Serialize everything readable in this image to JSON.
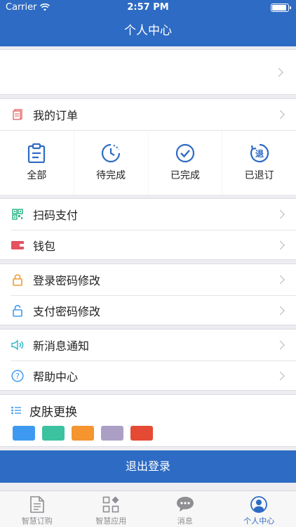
{
  "status_bar": {
    "carrier": "Carrier",
    "time": "2:57 PM"
  },
  "header": {
    "title": "个人中心"
  },
  "orders": {
    "title": "我的订单",
    "items": [
      {
        "label": "全部",
        "icon": "clipboard-icon"
      },
      {
        "label": "待完成",
        "icon": "clock-icon"
      },
      {
        "label": "已完成",
        "icon": "check-circle-icon"
      },
      {
        "label": "已退订",
        "icon": "refund-icon"
      }
    ]
  },
  "payment": {
    "scan_pay": "扫码支付",
    "wallet": "钱包"
  },
  "security": {
    "login_password": "登录密码修改",
    "pay_password": "支付密码修改"
  },
  "misc": {
    "notifications": "新消息通知",
    "help": "帮助中心"
  },
  "skin": {
    "title": "皮肤更换",
    "colors": [
      "#3e9af0",
      "#3dc2a0",
      "#f4952f",
      "#ab9fc6",
      "#e54a35"
    ]
  },
  "logout_label": "退出登录",
  "tabbar": {
    "tabs": [
      {
        "label": "智慧订购",
        "icon": "document-icon",
        "active": false
      },
      {
        "label": "智慧应用",
        "icon": "apps-icon",
        "active": false
      },
      {
        "label": "消息",
        "icon": "chat-icon",
        "active": false
      },
      {
        "label": "个人中心",
        "icon": "profile-icon",
        "active": true
      }
    ]
  },
  "colors": {
    "primary": "#2d6bc4",
    "background": "#ececf1"
  }
}
